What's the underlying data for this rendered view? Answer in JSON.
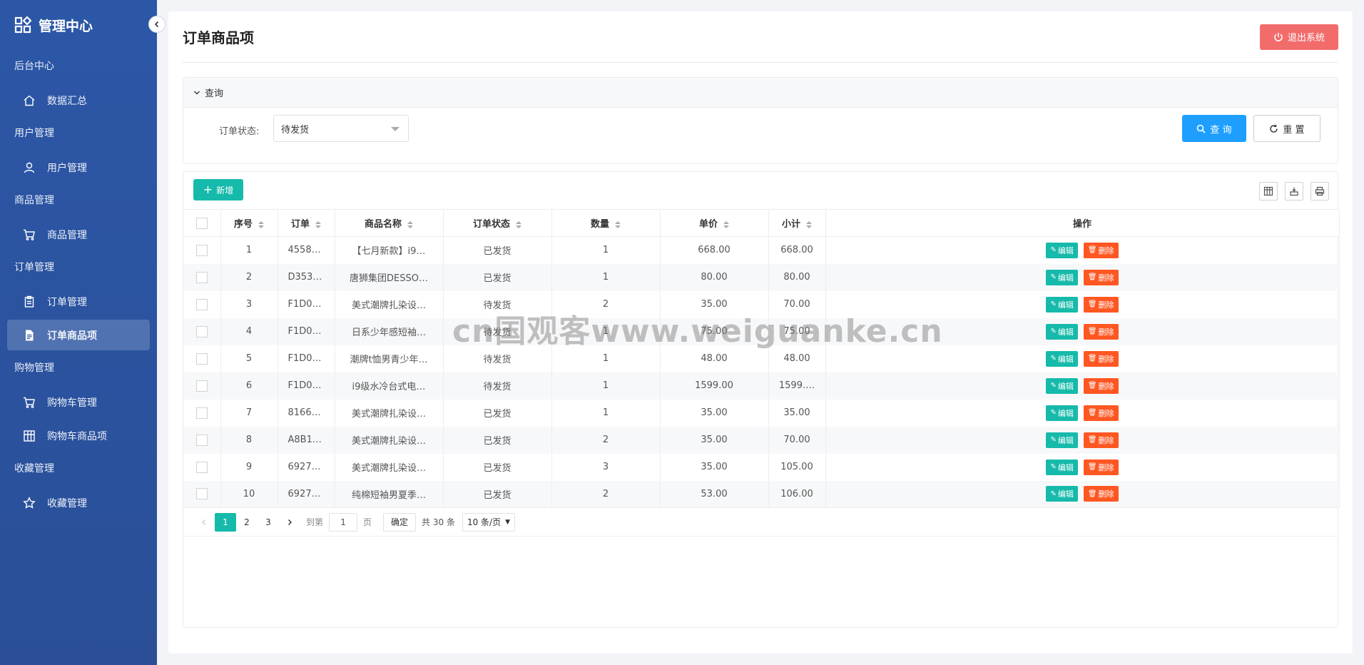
{
  "sidebar": {
    "brand": "管理中心",
    "groups": [
      {
        "title": "后台中心",
        "items": [
          {
            "label": "数据汇总",
            "icon": "home-icon"
          }
        ]
      },
      {
        "title": "用户管理",
        "items": [
          {
            "label": "用户管理",
            "icon": "user-icon"
          }
        ]
      },
      {
        "title": "商品管理",
        "items": [
          {
            "label": "商品管理",
            "icon": "cart-icon"
          }
        ]
      },
      {
        "title": "订单管理",
        "items": [
          {
            "label": "订单管理",
            "icon": "clipboard-icon"
          },
          {
            "label": "订单商品项",
            "icon": "document-icon",
            "active": true
          }
        ]
      },
      {
        "title": "购物管理",
        "items": [
          {
            "label": "购物车管理",
            "icon": "cart-icon"
          },
          {
            "label": "购物车商品项",
            "icon": "grid-icon"
          }
        ]
      },
      {
        "title": "收藏管理",
        "items": [
          {
            "label": "收藏管理",
            "icon": "star-icon"
          }
        ]
      }
    ]
  },
  "header": {
    "title": "订单商品项",
    "logout_label": "退出系统"
  },
  "query": {
    "section_label": "查询",
    "status_label": "订单状态:",
    "status_value": "待发货",
    "search_label": "查 询",
    "reset_label": "重 置"
  },
  "toolbar": {
    "add_label": "新增",
    "icons": [
      "columns-icon",
      "export-icon",
      "print-icon"
    ]
  },
  "table": {
    "columns": [
      "序号",
      "订单",
      "商品名称",
      "订单状态",
      "数量",
      "单价",
      "小计",
      "操作"
    ],
    "edit_label": "编辑",
    "delete_label": "删除",
    "rows": [
      {
        "no": "1",
        "order": "4558…",
        "name": "【七月新款】i9…",
        "status": "已发货",
        "qty": "1",
        "price": "668.00",
        "subtotal": "668.00"
      },
      {
        "no": "2",
        "order": "D353…",
        "name": "唐狮集团DESSO…",
        "status": "已发货",
        "qty": "1",
        "price": "80.00",
        "subtotal": "80.00"
      },
      {
        "no": "3",
        "order": "F1D0…",
        "name": "美式潮牌扎染设…",
        "status": "待发货",
        "qty": "2",
        "price": "35.00",
        "subtotal": "70.00"
      },
      {
        "no": "4",
        "order": "F1D0…",
        "name": "日系少年感短袖…",
        "status": "待发货",
        "qty": "1",
        "price": "75.00",
        "subtotal": "75.00"
      },
      {
        "no": "5",
        "order": "F1D0…",
        "name": "潮牌t恤男青少年…",
        "status": "待发货",
        "qty": "1",
        "price": "48.00",
        "subtotal": "48.00"
      },
      {
        "no": "6",
        "order": "F1D0…",
        "name": "i9级水冷台式电…",
        "status": "待发货",
        "qty": "1",
        "price": "1599.00",
        "subtotal": "1599.…"
      },
      {
        "no": "7",
        "order": "8166…",
        "name": "美式潮牌扎染设…",
        "status": "已发货",
        "qty": "1",
        "price": "35.00",
        "subtotal": "35.00"
      },
      {
        "no": "8",
        "order": "A8B1…",
        "name": "美式潮牌扎染设…",
        "status": "已发货",
        "qty": "2",
        "price": "35.00",
        "subtotal": "70.00"
      },
      {
        "no": "9",
        "order": "6927…",
        "name": "美式潮牌扎染设…",
        "status": "已发货",
        "qty": "3",
        "price": "35.00",
        "subtotal": "105.00"
      },
      {
        "no": "10",
        "order": "6927…",
        "name": "纯棉短袖男夏季…",
        "status": "已发货",
        "qty": "2",
        "price": "53.00",
        "subtotal": "106.00"
      }
    ]
  },
  "pager": {
    "pages": [
      "1",
      "2",
      "3"
    ],
    "current": "1",
    "goto_label": "到第",
    "goto_value": "1",
    "page_unit": "页",
    "confirm_label": "确定",
    "total_label": "共 30 条",
    "page_size": "10 条/页"
  },
  "watermark": "cn国观客www.weiguanke.cn"
}
